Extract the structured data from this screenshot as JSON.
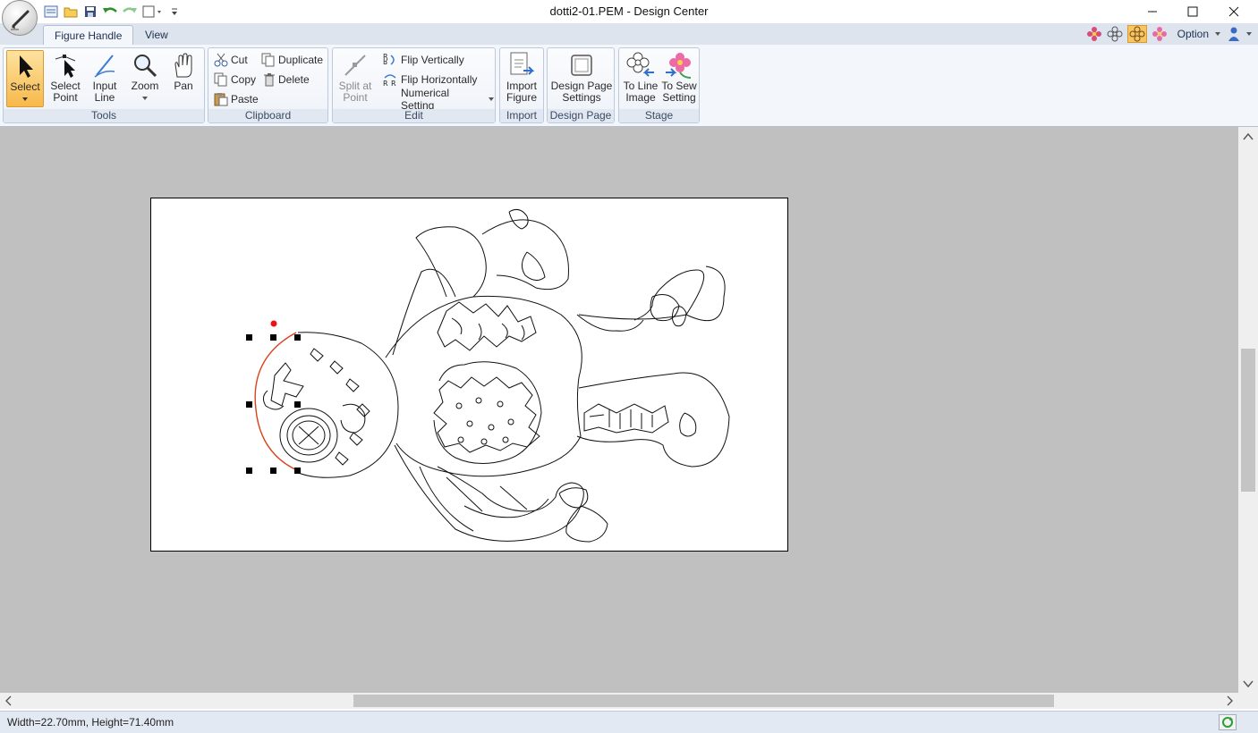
{
  "window": {
    "title": "dotti2-01.PEM - Design Center"
  },
  "quick_access": {
    "icons": [
      "new-icon",
      "open-icon",
      "save-icon",
      "undo-icon",
      "redo-icon",
      "frame-icon",
      "customize-icon"
    ]
  },
  "tabs": [
    {
      "label": "Figure Handle",
      "active": true
    },
    {
      "label": "View",
      "active": false
    }
  ],
  "right_toolbar": {
    "option_label": "Option"
  },
  "ribbon": {
    "tools": {
      "label": "Tools",
      "select": "Select",
      "select_point_1": "Select",
      "select_point_2": "Point",
      "input_line_1": "Input",
      "input_line_2": "Line",
      "zoom": "Zoom",
      "pan": "Pan"
    },
    "clipboard": {
      "label": "Clipboard",
      "cut": "Cut",
      "duplicate": "Duplicate",
      "copy": "Copy",
      "delete": "Delete",
      "paste": "Paste"
    },
    "edit": {
      "label": "Edit",
      "split_1": "Split at",
      "split_2": "Point",
      "flip_v": "Flip Vertically",
      "flip_h": "Flip Horizontally",
      "numerical": "Numerical Setting"
    },
    "import": {
      "label": "Import",
      "import_1": "Import",
      "import_2": "Figure"
    },
    "design_page": {
      "label": "Design Page",
      "settings_1": "Design Page",
      "settings_2": "Settings"
    },
    "stage": {
      "label": "Stage",
      "line_1": "To Line",
      "line_2": "Image",
      "sew_1": "To Sew",
      "sew_2": "Setting"
    }
  },
  "status": {
    "text": "Width=22.70mm, Height=71.40mm"
  },
  "colors": {
    "accent_active": "#f8b94b",
    "selection_curve": "#d9441c",
    "workspace": "#c0c0c0"
  }
}
